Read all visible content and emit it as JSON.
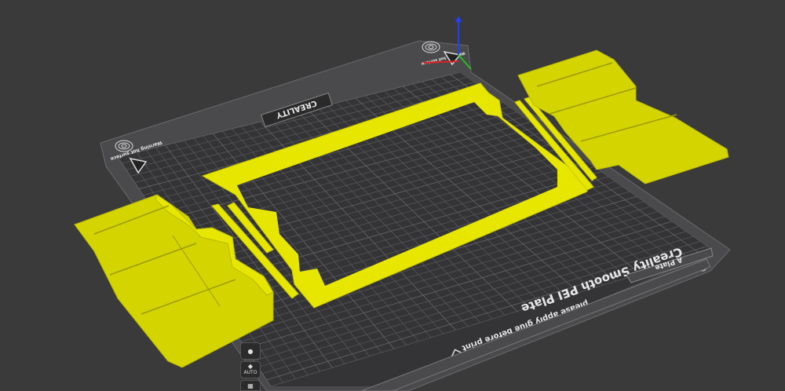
{
  "app": "Creality Print slicer – 3D build plate view",
  "plate": {
    "brand": "CREALITY",
    "title": "Creality Smooth PEI Plate",
    "subtitle": "please apply glue before print",
    "warning": "Warning hot surface",
    "plate_name": "A Plate"
  },
  "toolbar": {
    "auto_label": "AUTO"
  },
  "colors": {
    "background": "#3a3a3b",
    "plate": "#2f2f30",
    "grid": "#5a5a5c",
    "model": "#e6e600",
    "axis_x": "#e02020",
    "axis_y": "#20c020",
    "axis_z": "#2040ff"
  },
  "icons": [
    "fingerprint-icon",
    "warning-triangle-icon",
    "lock-icon",
    "auto-orient-icon",
    "arrange-icon",
    "edit-plate-icon"
  ]
}
